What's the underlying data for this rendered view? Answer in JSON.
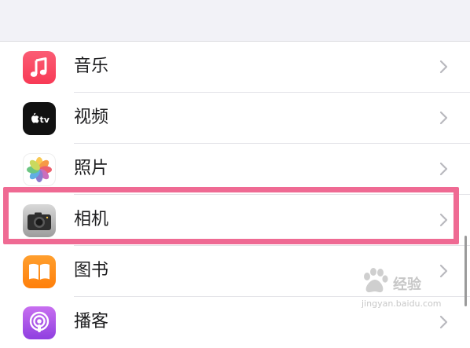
{
  "settings": {
    "items": [
      {
        "label": "音乐",
        "icon": "music-app-icon",
        "color": "#fa4a63"
      },
      {
        "label": "视频",
        "icon": "apple-tv-app-icon",
        "icon_text": "tv",
        "color": "#111111"
      },
      {
        "label": "照片",
        "icon": "photos-app-icon",
        "color": "#ffffff"
      },
      {
        "label": "相机",
        "icon": "camera-app-icon",
        "color": "#b5b5b5"
      },
      {
        "label": "图书",
        "icon": "books-app-icon",
        "color": "#ff8c1a"
      },
      {
        "label": "播客",
        "icon": "podcasts-app-icon",
        "color": "#b35bea"
      }
    ]
  },
  "highlight": {
    "color": "#ef6a93",
    "target": "相机"
  },
  "watermark": {
    "text": "经验",
    "url": "jingyan.baidu.com",
    "logo": "baidu-paw-icon"
  }
}
